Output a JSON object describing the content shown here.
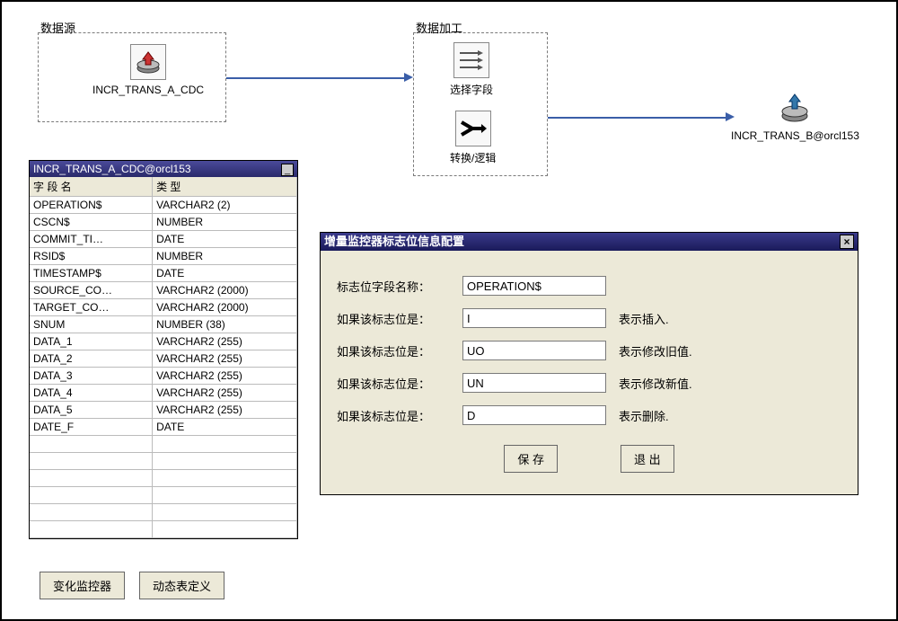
{
  "flow": {
    "source_group_title": "数据源",
    "source_node_label": "INCR_TRANS_A_CDC",
    "process_group_title": "数据加工",
    "process_select_label": "选择字段",
    "process_transform_label": "转换/逻辑",
    "target_node_label": "INCR_TRANS_B@orcl153"
  },
  "schema_window": {
    "title": "INCR_TRANS_A_CDC@orcl153",
    "col_name_header": "字 段 名",
    "col_type_header": "类    型",
    "rows": [
      {
        "name": "OPERATION$",
        "type": "VARCHAR2 (2)"
      },
      {
        "name": "CSCN$",
        "type": "NUMBER"
      },
      {
        "name": "COMMIT_TI…",
        "type": "DATE"
      },
      {
        "name": "RSID$",
        "type": "NUMBER"
      },
      {
        "name": "TIMESTAMP$",
        "type": "DATE"
      },
      {
        "name": "SOURCE_CO…",
        "type": "VARCHAR2 (2000)"
      },
      {
        "name": "TARGET_CO…",
        "type": "VARCHAR2 (2000)"
      },
      {
        "name": "SNUM",
        "type": "NUMBER (38)"
      },
      {
        "name": "DATA_1",
        "type": "VARCHAR2 (255)"
      },
      {
        "name": "DATA_2",
        "type": "VARCHAR2 (255)"
      },
      {
        "name": "DATA_3",
        "type": "VARCHAR2 (255)"
      },
      {
        "name": "DATA_4",
        "type": "VARCHAR2 (255)"
      },
      {
        "name": "DATA_5",
        "type": "VARCHAR2 (255)"
      },
      {
        "name": "DATE_F",
        "type": "DATE"
      }
    ]
  },
  "bottom_buttons": {
    "monitor": "变化监控器",
    "dyn_table": "动态表定义"
  },
  "dialog": {
    "title": "增量监控器标志位信息配置",
    "label_field_name": "标志位字段名称：",
    "value_field_name": "OPERATION$",
    "row_insert_label": "如果该标志位是：",
    "row_insert_value": "I",
    "row_insert_suffix": "表示插入.",
    "row_uo_label": "如果该标志位是：",
    "row_uo_value": "UO",
    "row_uo_suffix": "表示修改旧值.",
    "row_un_label": "如果该标志位是：",
    "row_un_value": "UN",
    "row_un_suffix": "表示修改新值.",
    "row_delete_label": "如果该标志位是：",
    "row_delete_value": "D",
    "row_delete_suffix": "表示删除.",
    "btn_save": "保 存",
    "btn_exit": "退 出"
  }
}
